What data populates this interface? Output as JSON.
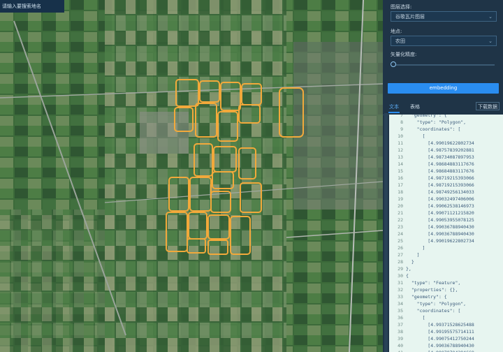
{
  "map": {
    "search_placeholder": "请输入要搜索地名"
  },
  "panel": {
    "layer_label": "图层选择:",
    "layer_value": "谷歌瓦片图层",
    "place_label": "地点:",
    "place_value": "农田",
    "precision_label": "矢量化精度:",
    "precision_value": 0,
    "embedding_button": "embedding",
    "tabs": [
      "文本",
      "表格"
    ],
    "active_tab": 0,
    "download_button": "下载数据"
  },
  "code": {
    "lines": [
      {
        "n": "7",
        "t": "  \"geometry\": {"
      },
      {
        "n": "8",
        "t": "    \"type\": \"Polygon\","
      },
      {
        "n": "9",
        "t": "    \"coordinates\": ["
      },
      {
        "n": "10",
        "t": "      ["
      },
      {
        "n": "11",
        "t": "        [4.99019622802734"
      },
      {
        "n": "12",
        "t": "        [4.98757839202881"
      },
      {
        "n": "13",
        "t": "        [4.98734087897953"
      },
      {
        "n": "14",
        "t": "        [4.98684883117676"
      },
      {
        "n": "15",
        "t": "        [4.98684883117676"
      },
      {
        "n": "16",
        "t": "        [4.98719215393066"
      },
      {
        "n": "17",
        "t": "        [4.98719215393066"
      },
      {
        "n": "18",
        "t": "        [4.98749256134033"
      },
      {
        "n": "19",
        "t": "        [4.99032497406006"
      },
      {
        "n": "20",
        "t": "        [4.99062538146973"
      },
      {
        "n": "21",
        "t": "        [4.99071121215820"
      },
      {
        "n": "22",
        "t": "        [4.99053955078125"
      },
      {
        "n": "23",
        "t": "        [4.99036788940430"
      },
      {
        "n": "24",
        "t": "        [4.99036788940430"
      },
      {
        "n": "25",
        "t": "        [4.99019622802734"
      },
      {
        "n": "26",
        "t": "      ]"
      },
      {
        "n": "27",
        "t": "    ]"
      },
      {
        "n": "28",
        "t": "  }"
      },
      {
        "n": "29",
        "t": "},"
      },
      {
        "n": "30",
        "t": "{"
      },
      {
        "n": "31",
        "t": "  \"type\": \"Feature\","
      },
      {
        "n": "32",
        "t": "  \"properties\": {},"
      },
      {
        "n": "33",
        "t": "  \"geometry\": {"
      },
      {
        "n": "34",
        "t": "    \"type\": \"Polygon\","
      },
      {
        "n": "35",
        "t": "    \"coordinates\": ["
      },
      {
        "n": "36",
        "t": "      ["
      },
      {
        "n": "37",
        "t": "        [4.99371528625488"
      },
      {
        "n": "38",
        "t": "        [4.99195575714111"
      },
      {
        "n": "39",
        "t": "        [4.99075412750244"
      },
      {
        "n": "40",
        "t": "        [4.99036788940430"
      },
      {
        "n": "41",
        "t": "        [4.99079704284668"
      }
    ]
  },
  "colors": {
    "polygon_outline": "#f2a93b",
    "accent": "#2a8df0"
  }
}
